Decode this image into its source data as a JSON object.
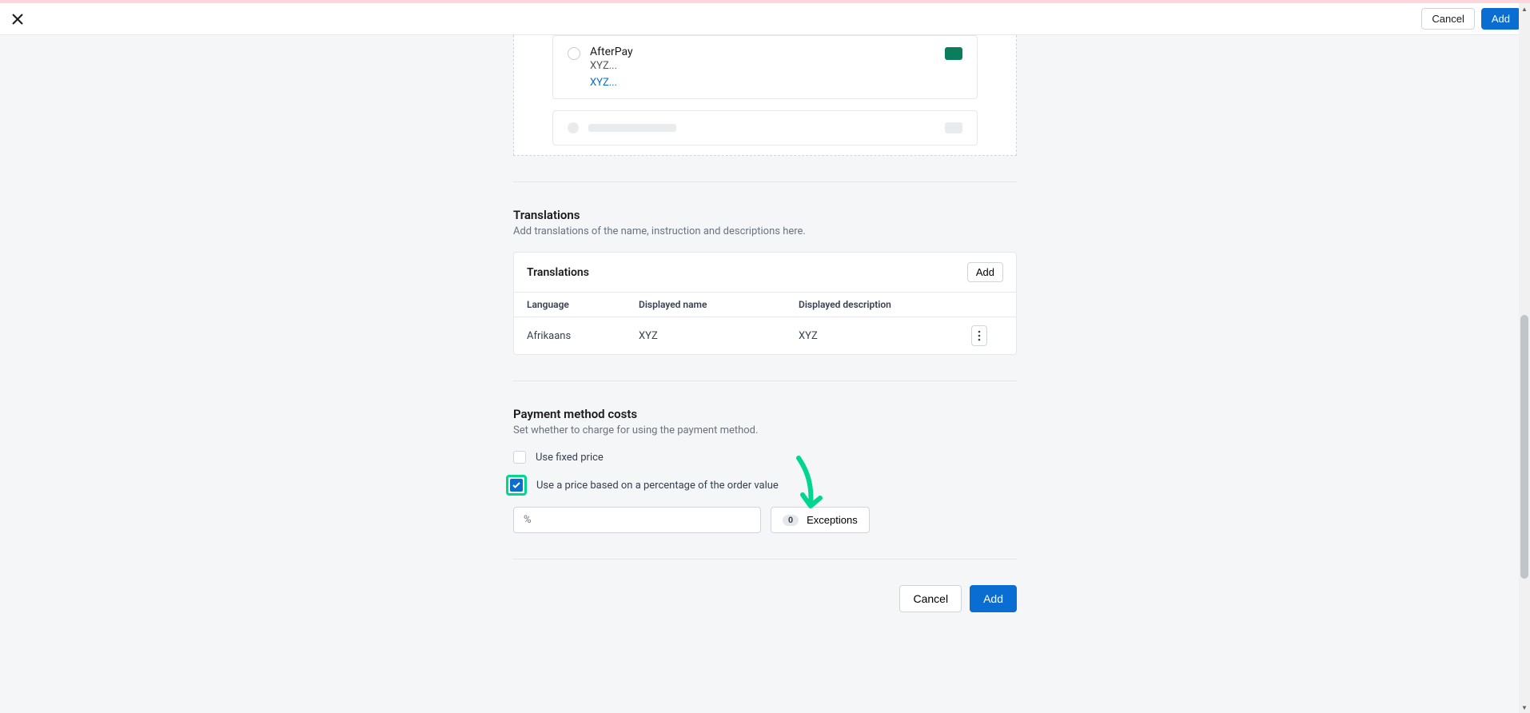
{
  "header": {
    "cancel_label": "Cancel",
    "add_label": "Add"
  },
  "preview": {
    "title": "AfterPay",
    "subtitle": "XYZ...",
    "link": "XYZ..."
  },
  "translations": {
    "section_title": "Translations",
    "section_desc": "Add translations of the name, instruction and descriptions here.",
    "panel_title": "Translations",
    "add_label": "Add",
    "col_language": "Language",
    "col_displayed_name": "Displayed name",
    "col_displayed_desc": "Displayed description",
    "rows": [
      {
        "language": "Afrikaans",
        "name": "XYZ",
        "desc": "XYZ"
      }
    ]
  },
  "payment_costs": {
    "section_title": "Payment method costs",
    "section_desc": "Set whether to charge for using the payment method.",
    "fixed_price_label": "Use fixed price",
    "percentage_label": "Use a price based on a percentage of the order value",
    "exceptions_count": "0",
    "exceptions_label": "Exceptions"
  },
  "footer": {
    "cancel_label": "Cancel",
    "add_label": "Add"
  }
}
